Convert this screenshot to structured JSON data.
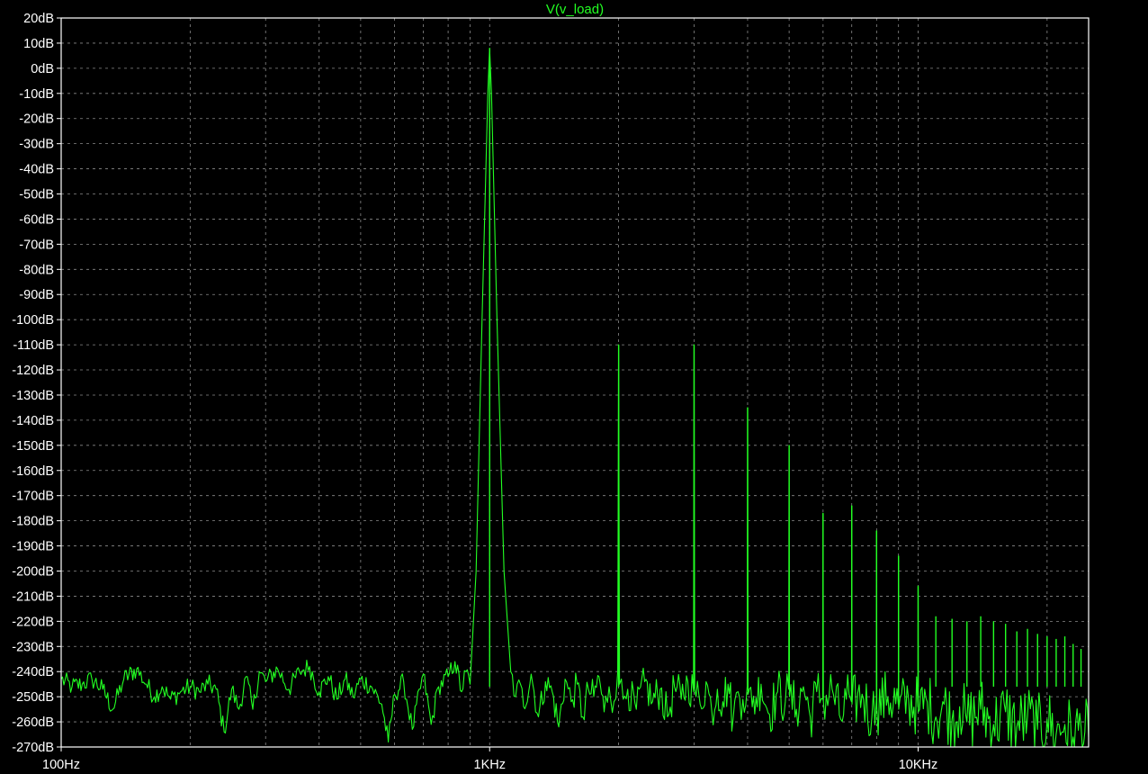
{
  "chart_data": {
    "type": "line",
    "title": "V(v_load)",
    "x_scale": "log",
    "xlim": [
      100,
      25000
    ],
    "ylim": [
      -270,
      20
    ],
    "y_unit": "dB",
    "x_ticks": [
      {
        "value": 100,
        "label": "100Hz"
      },
      {
        "value": 1000,
        "label": "1KHz"
      },
      {
        "value": 10000,
        "label": "10KHz"
      }
    ],
    "y_ticks": [
      {
        "value": 20,
        "label": "20dB"
      },
      {
        "value": 10,
        "label": "10dB"
      },
      {
        "value": 0,
        "label": "0dB"
      },
      {
        "value": -10,
        "label": "-10dB"
      },
      {
        "value": -20,
        "label": "-20dB"
      },
      {
        "value": -30,
        "label": "-30dB"
      },
      {
        "value": -40,
        "label": "-40dB"
      },
      {
        "value": -50,
        "label": "-50dB"
      },
      {
        "value": -60,
        "label": "-60dB"
      },
      {
        "value": -70,
        "label": "-70dB"
      },
      {
        "value": -80,
        "label": "-80dB"
      },
      {
        "value": -90,
        "label": "-90dB"
      },
      {
        "value": -100,
        "label": "-100dB"
      },
      {
        "value": -110,
        "label": "-110dB"
      },
      {
        "value": -120,
        "label": "-120dB"
      },
      {
        "value": -130,
        "label": "-130dB"
      },
      {
        "value": -140,
        "label": "-140dB"
      },
      {
        "value": -150,
        "label": "-150dB"
      },
      {
        "value": -160,
        "label": "-160dB"
      },
      {
        "value": -170,
        "label": "-170dB"
      },
      {
        "value": -180,
        "label": "-180dB"
      },
      {
        "value": -190,
        "label": "-190dB"
      },
      {
        "value": -200,
        "label": "-200dB"
      },
      {
        "value": -210,
        "label": "-210dB"
      },
      {
        "value": -220,
        "label": "-220dB"
      },
      {
        "value": -230,
        "label": "-230dB"
      },
      {
        "value": -240,
        "label": "-240dB"
      },
      {
        "value": -250,
        "label": "-250dB"
      },
      {
        "value": -260,
        "label": "-260dB"
      },
      {
        "value": -270,
        "label": "-270dB"
      }
    ],
    "grid": true,
    "series": [
      {
        "name": "V(v_load)",
        "color": "#22ff22",
        "points": [
          [
            100,
            -243
          ],
          [
            106,
            -246
          ],
          [
            112,
            -245
          ],
          [
            118,
            -243
          ],
          [
            125,
            -247
          ],
          [
            132,
            -255
          ],
          [
            140,
            -243
          ],
          [
            150,
            -239
          ],
          [
            158,
            -245
          ],
          [
            165,
            -250
          ],
          [
            172,
            -246
          ],
          [
            180,
            -251
          ],
          [
            190,
            -248
          ],
          [
            200,
            -246
          ],
          [
            210,
            -248
          ],
          [
            220,
            -245
          ],
          [
            230,
            -247
          ],
          [
            240,
            -264
          ],
          [
            250,
            -247
          ],
          [
            260,
            -255
          ],
          [
            270,
            -242
          ],
          [
            280,
            -255
          ],
          [
            290,
            -240
          ],
          [
            300,
            -244
          ],
          [
            320,
            -239
          ],
          [
            340,
            -247
          ],
          [
            360,
            -240
          ],
          [
            380,
            -238
          ],
          [
            400,
            -248
          ],
          [
            420,
            -242
          ],
          [
            440,
            -251
          ],
          [
            460,
            -243
          ],
          [
            480,
            -250
          ],
          [
            500,
            -243
          ],
          [
            530,
            -246
          ],
          [
            560,
            -253
          ],
          [
            580,
            -268
          ],
          [
            600,
            -249
          ],
          [
            630,
            -244
          ],
          [
            660,
            -263
          ],
          [
            700,
            -241
          ],
          [
            730,
            -261
          ],
          [
            760,
            -246
          ],
          [
            800,
            -242
          ],
          [
            830,
            -236
          ],
          [
            860,
            -248
          ],
          [
            880,
            -240
          ],
          [
            900,
            -245
          ],
          [
            930,
            -200
          ],
          [
            960,
            -100
          ],
          [
            990,
            -10
          ],
          [
            1000,
            8
          ],
          [
            1010,
            -10
          ],
          [
            1040,
            -100
          ],
          [
            1080,
            -200
          ],
          [
            1120,
            -240
          ],
          [
            1150,
            -250
          ],
          [
            1180,
            -245
          ],
          [
            1200,
            -254
          ],
          [
            1250,
            -241
          ],
          [
            1300,
            -258
          ],
          [
            1350,
            -244
          ],
          [
            1400,
            -248
          ],
          [
            1450,
            -262
          ],
          [
            1500,
            -243
          ],
          [
            1550,
            -252
          ],
          [
            1600,
            -245
          ],
          [
            1650,
            -258
          ],
          [
            1700,
            -247
          ],
          [
            1750,
            -250
          ],
          [
            1800,
            -242
          ],
          [
            1850,
            -256
          ],
          [
            1900,
            -246
          ],
          [
            1950,
            -252
          ],
          [
            1990,
            -240
          ],
          [
            2000,
            -110
          ],
          [
            2010,
            -245
          ],
          [
            2050,
            -251
          ],
          [
            2100,
            -247
          ],
          [
            2200,
            -255
          ],
          [
            2300,
            -244
          ],
          [
            2400,
            -252
          ],
          [
            2500,
            -247
          ],
          [
            2600,
            -258
          ],
          [
            2700,
            -246
          ],
          [
            2800,
            -251
          ],
          [
            2900,
            -244
          ],
          [
            2990,
            -248
          ],
          [
            3000,
            -110
          ],
          [
            3010,
            -247
          ],
          [
            3100,
            -253
          ],
          [
            3200,
            -244
          ],
          [
            3300,
            -256
          ],
          [
            3400,
            -247
          ],
          [
            3500,
            -252
          ],
          [
            3600,
            -245
          ],
          [
            3700,
            -259
          ],
          [
            3800,
            -248
          ],
          [
            3900,
            -251
          ],
          [
            3990,
            -246
          ],
          [
            4000,
            -135
          ],
          [
            4010,
            -249
          ],
          [
            4100,
            -254
          ],
          [
            4300,
            -245
          ],
          [
            4500,
            -257
          ],
          [
            4700,
            -248
          ],
          [
            4900,
            -252
          ],
          [
            4990,
            -247
          ],
          [
            5000,
            -150
          ],
          [
            5010,
            -250
          ],
          [
            5200,
            -255
          ],
          [
            5400,
            -246
          ],
          [
            5600,
            -258
          ],
          [
            5800,
            -248
          ],
          [
            5990,
            -251
          ],
          [
            6000,
            -177
          ],
          [
            6010,
            -252
          ],
          [
            6300,
            -247
          ],
          [
            6600,
            -259
          ],
          [
            6900,
            -249
          ],
          [
            6990,
            -252
          ],
          [
            7000,
            -174
          ],
          [
            7010,
            -253
          ],
          [
            7400,
            -249
          ],
          [
            7800,
            -258
          ],
          [
            7990,
            -251
          ],
          [
            8000,
            -184
          ],
          [
            8010,
            -254
          ],
          [
            8500,
            -250
          ],
          [
            8990,
            -253
          ],
          [
            9000,
            -194
          ],
          [
            9010,
            -255
          ],
          [
            9500,
            -251
          ],
          [
            9990,
            -254
          ],
          [
            10000,
            -206
          ],
          [
            10010,
            -256
          ],
          [
            10500,
            -252
          ],
          [
            11000,
            -258
          ],
          [
            11500,
            -253
          ],
          [
            12000,
            -259
          ],
          [
            12500,
            -254
          ],
          [
            13000,
            -260
          ],
          [
            14000,
            -255
          ],
          [
            15000,
            -261
          ],
          [
            16000,
            -256
          ],
          [
            17000,
            -262
          ],
          [
            18000,
            -258
          ],
          [
            19000,
            -263
          ],
          [
            20000,
            -259
          ],
          [
            21000,
            -265
          ],
          [
            22000,
            -261
          ],
          [
            23000,
            -266
          ],
          [
            24000,
            -262
          ],
          [
            25000,
            -266
          ]
        ],
        "harmonic_peaks": [
          [
            1000,
            8
          ],
          [
            2000,
            -110
          ],
          [
            3000,
            -110
          ],
          [
            4000,
            -135
          ],
          [
            5000,
            -150
          ],
          [
            6000,
            -177
          ],
          [
            7000,
            -174
          ],
          [
            8000,
            -184
          ],
          [
            9000,
            -194
          ],
          [
            10000,
            -206
          ],
          [
            11000,
            -218
          ],
          [
            12000,
            -219
          ],
          [
            13000,
            -220
          ],
          [
            14000,
            -218
          ],
          [
            15000,
            -220
          ],
          [
            16000,
            -221
          ],
          [
            17000,
            -224
          ],
          [
            18000,
            -223
          ],
          [
            19000,
            -225
          ],
          [
            20000,
            -226
          ],
          [
            21000,
            -227
          ],
          [
            22000,
            -226
          ],
          [
            23000,
            -229
          ],
          [
            24000,
            -231
          ]
        ]
      }
    ]
  }
}
